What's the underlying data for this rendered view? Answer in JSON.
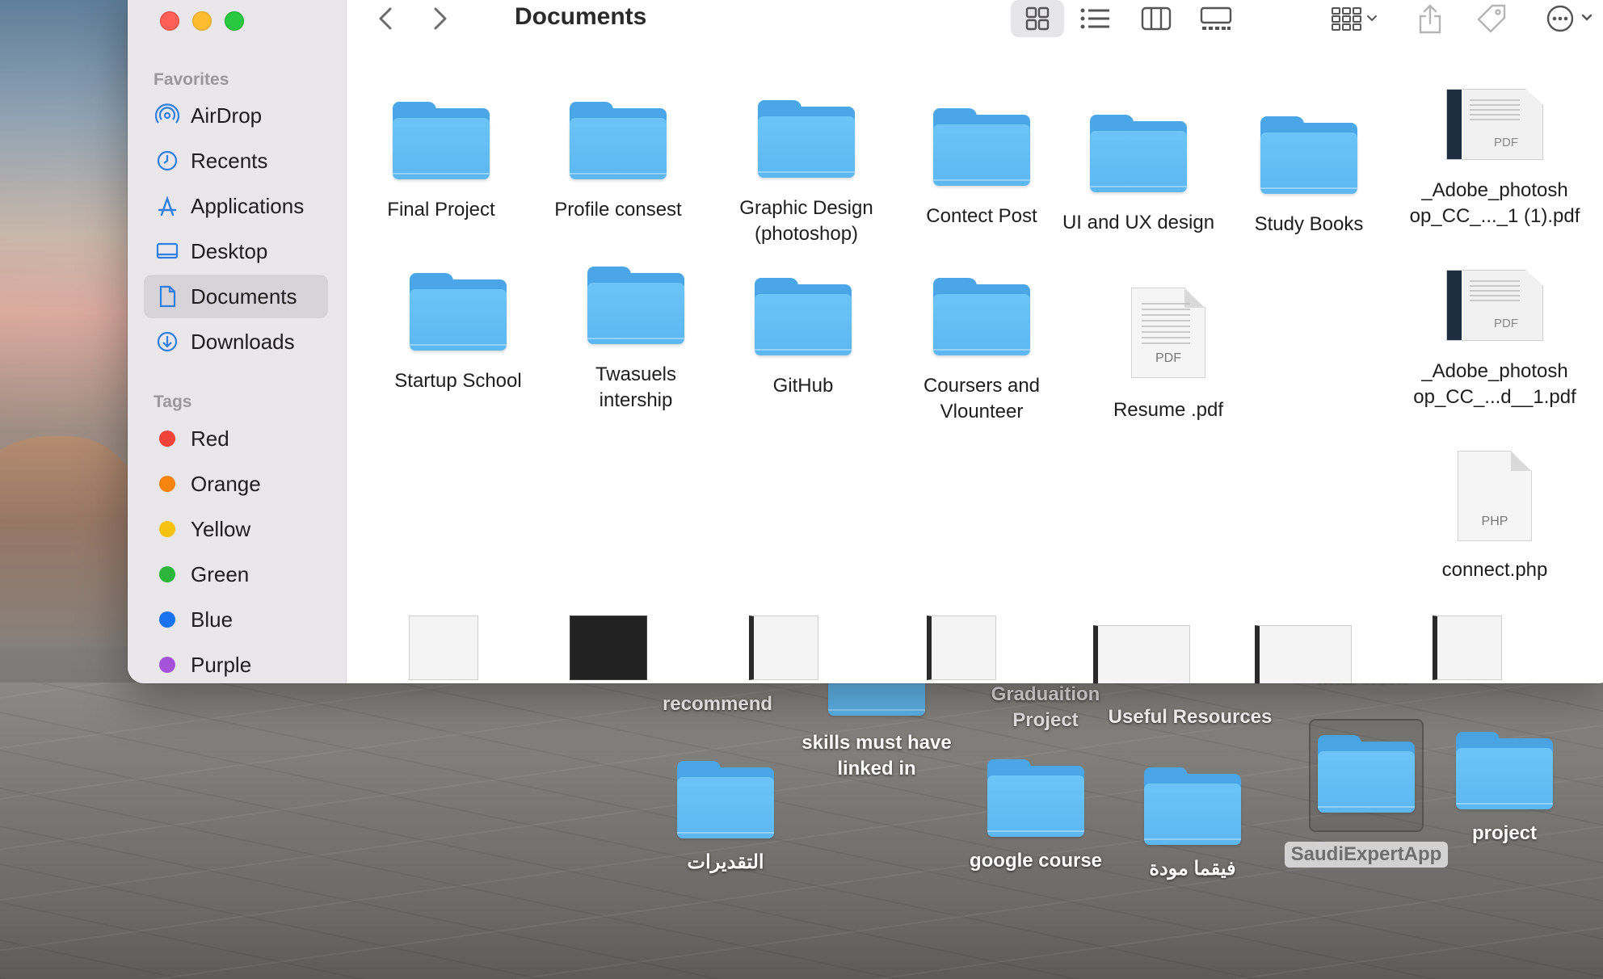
{
  "window": {
    "title": "Documents"
  },
  "sidebar": {
    "favorites_heading": "Favorites",
    "favorites": [
      {
        "label": "AirDrop",
        "icon": "airdrop-icon"
      },
      {
        "label": "Recents",
        "icon": "clock-icon"
      },
      {
        "label": "Applications",
        "icon": "applications-icon"
      },
      {
        "label": "Desktop",
        "icon": "desktop-icon"
      },
      {
        "label": "Documents",
        "icon": "document-icon",
        "active": true
      },
      {
        "label": "Downloads",
        "icon": "download-icon"
      }
    ],
    "tags_heading": "Tags",
    "tags": [
      {
        "label": "Red",
        "color": "#f0433a"
      },
      {
        "label": "Orange",
        "color": "#f6850f"
      },
      {
        "label": "Yellow",
        "color": "#f5c30f"
      },
      {
        "label": "Green",
        "color": "#2bb63b"
      },
      {
        "label": "Blue",
        "color": "#1a72f0"
      },
      {
        "label": "Purple",
        "color": "#a453d8"
      }
    ]
  },
  "toolbar": {
    "icons": [
      "back-icon",
      "forward-icon",
      "icon-view-icon",
      "list-view-icon",
      "column-view-icon",
      "gallery-view-icon",
      "group-icon",
      "share-icon",
      "tag-icon",
      "more-icon",
      "search-icon"
    ]
  },
  "files": [
    {
      "name": "Final Project",
      "kind": "folder"
    },
    {
      "name": "Profile consest",
      "kind": "folder"
    },
    {
      "name": "Graphic Design\n(photoshop)",
      "kind": "folder"
    },
    {
      "name": "Contect Post",
      "kind": "folder"
    },
    {
      "name": "UI and UX design",
      "kind": "folder"
    },
    {
      "name": "Study Books",
      "kind": "folder"
    },
    {
      "name": "_Adobe_photosh\nop_CC_..._1 (1).pdf",
      "kind": "pdf",
      "ext": "PDF"
    },
    {
      "name": "Startup School",
      "kind": "folder"
    },
    {
      "name": "Twasuels\nintership",
      "kind": "folder"
    },
    {
      "name": "GitHub",
      "kind": "folder"
    },
    {
      "name": "Coursers and\nVlounteer",
      "kind": "folder"
    },
    {
      "name": "Resume .pdf",
      "kind": "doc",
      "ext": "PDF"
    },
    {
      "name": "_Adobe_photosh\nop_CC_...d__1.pdf",
      "kind": "pdf",
      "ext": "PDF"
    },
    {
      "name": "connect.php",
      "kind": "doc",
      "ext": "PHP"
    }
  ],
  "desktop": [
    {
      "name": "recommend"
    },
    {
      "name": "skills must have\nlinked in"
    },
    {
      "name": "Graduaition\nProject"
    },
    {
      "name": "Useful Resources"
    },
    {
      "name": "final work"
    },
    {
      "name": "التقديرات"
    },
    {
      "name": "google course"
    },
    {
      "name": "فيقما مودة"
    },
    {
      "name": "SaudiExpertApp",
      "selected": true
    },
    {
      "name": "project"
    }
  ]
}
